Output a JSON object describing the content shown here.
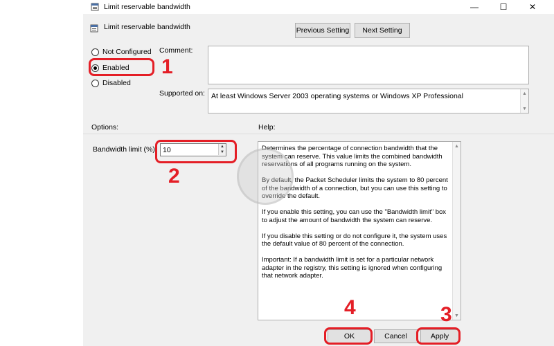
{
  "window": {
    "title": "Limit reservable bandwidth",
    "minimize_glyph": "—",
    "maximize_glyph": "☐",
    "close_glyph": "✕"
  },
  "header": {
    "title": "Limit reservable bandwidth",
    "previous_setting": "Previous Setting",
    "next_setting": "Next Setting"
  },
  "state": {
    "options": [
      {
        "label": "Not Configured",
        "selected": false
      },
      {
        "label": "Enabled",
        "selected": true
      },
      {
        "label": "Disabled",
        "selected": false
      }
    ]
  },
  "comment": {
    "label": "Comment:",
    "value": ""
  },
  "supported": {
    "label": "Supported on:",
    "value": "At least Windows Server 2003 operating systems or Windows XP Professional"
  },
  "options_section": {
    "label": "Options:",
    "bandwidth_label": "Bandwidth limit (%):",
    "bandwidth_value": "10"
  },
  "help": {
    "label": "Help:",
    "paragraphs": [
      "Determines the percentage of connection bandwidth that the system can reserve. This value limits the combined bandwidth reservations of all programs running on the system.",
      "By default, the Packet Scheduler limits the system to 80 percent of the bandwidth of a connection, but you can use this setting to override the default.",
      "If you enable this setting, you can use the \"Bandwidth limit\" box to adjust the amount of bandwidth the system can reserve.",
      "If you disable this setting or do not configure it, the system uses the default value of 80 percent of the connection.",
      "Important: If a bandwidth limit is set for a particular network adapter in the registry, this setting is ignored when configuring that network adapter."
    ]
  },
  "buttons": {
    "ok": "OK",
    "cancel": "Cancel",
    "apply": "Apply"
  },
  "annotations": {
    "one": "1",
    "two": "2",
    "three": "3",
    "four": "4",
    "color": "#e41e26"
  },
  "icons": {
    "window": "policy-icon",
    "header": "policy-icon"
  }
}
